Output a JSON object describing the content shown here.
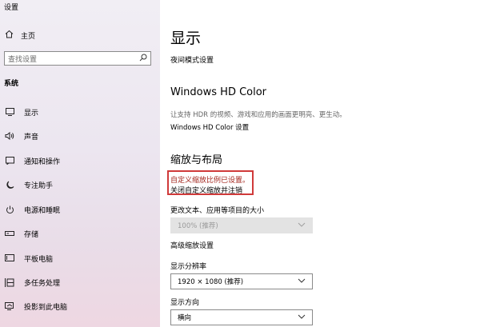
{
  "app": {
    "title": "设置"
  },
  "sidebar": {
    "home_label": "主页",
    "search_placeholder": "查找设置",
    "section_label": "系统",
    "items": [
      {
        "label": "显示",
        "icon": "monitor-icon"
      },
      {
        "label": "声音",
        "icon": "speaker-icon"
      },
      {
        "label": "通知和操作",
        "icon": "notification-icon"
      },
      {
        "label": "专注助手",
        "icon": "moon-icon"
      },
      {
        "label": "电源和睡眠",
        "icon": "power-icon"
      },
      {
        "label": "存储",
        "icon": "storage-icon"
      },
      {
        "label": "平板电脑",
        "icon": "tablet-icon"
      },
      {
        "label": "多任务处理",
        "icon": "multitasking-icon"
      },
      {
        "label": "投影到此电脑",
        "icon": "project-icon"
      }
    ]
  },
  "main": {
    "title": "显示",
    "night_light_link": "夜间模式设置",
    "hdr": {
      "heading": "Windows HD Color",
      "description": "让支持 HDR 的视频、游戏和应用的画面更明亮、更生动。",
      "link": "Windows HD Color 设置"
    },
    "scale": {
      "heading": "缩放与布局",
      "warning": "自定义缩放比例已设置。",
      "warning_link": "关闭自定义缩放并注销",
      "size_label": "更改文本、应用等项目的大小",
      "size_value": "100% (推荐)",
      "advanced_link": "高级缩放设置",
      "resolution_label": "显示分辨率",
      "resolution_value": "1920 × 1080 (推荐)",
      "orientation_label": "显示方向",
      "orientation_value": "横向"
    }
  },
  "colors": {
    "warning_text": "#a3261e",
    "warning_border": "#d03a3a",
    "disabled_bg": "#e3e3e3"
  }
}
